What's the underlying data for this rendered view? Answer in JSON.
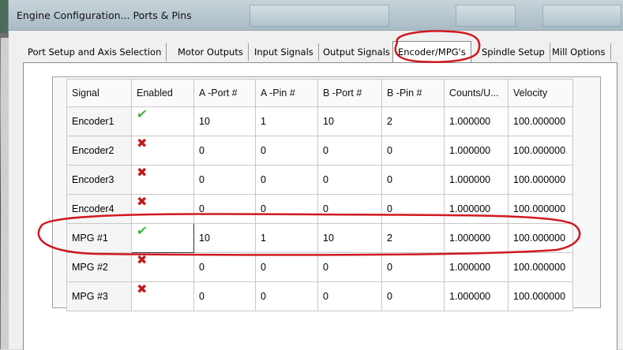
{
  "window": {
    "title": "Engine Configuration... Ports & Pins"
  },
  "tabs": [
    {
      "label": "Port Setup and Axis Selection"
    },
    {
      "label": "Motor Outputs"
    },
    {
      "label": "Input Signals"
    },
    {
      "label": "Output Signals"
    },
    {
      "label": "Encoder/MPG's"
    },
    {
      "label": "Spindle Setup"
    },
    {
      "label": "Mill Options"
    }
  ],
  "active_tab": "Encoder/MPG's",
  "grid": {
    "columns": [
      "Signal",
      "Enabled",
      "A -Port #",
      "A -Pin  #",
      "B -Port #",
      "B -Pin  #",
      "Counts/U...",
      "Velocity"
    ],
    "rows": [
      {
        "signal": "Encoder1",
        "enabled": true,
        "a_port": "10",
        "a_pin": "1",
        "b_port": "10",
        "b_pin": "2",
        "counts": "1.000000",
        "velocity": "100.000000"
      },
      {
        "signal": "Encoder2",
        "enabled": false,
        "a_port": "0",
        "a_pin": "0",
        "b_port": "0",
        "b_pin": "0",
        "counts": "1.000000",
        "velocity": "100.000000"
      },
      {
        "signal": "Encoder3",
        "enabled": false,
        "a_port": "0",
        "a_pin": "0",
        "b_port": "0",
        "b_pin": "0",
        "counts": "1.000000",
        "velocity": "100.000000"
      },
      {
        "signal": "Encoder4",
        "enabled": false,
        "a_port": "0",
        "a_pin": "0",
        "b_port": "0",
        "b_pin": "0",
        "counts": "1.000000",
        "velocity": "100.000000"
      },
      {
        "signal": "MPG #1",
        "enabled": true,
        "a_port": "10",
        "a_pin": "1",
        "b_port": "10",
        "b_pin": "2",
        "counts": "1.000000",
        "velocity": "100.000000"
      },
      {
        "signal": "MPG #2",
        "enabled": false,
        "a_port": "0",
        "a_pin": "0",
        "b_port": "0",
        "b_pin": "0",
        "counts": "1.000000",
        "velocity": "100.000000"
      },
      {
        "signal": "MPG #3",
        "enabled": false,
        "a_port": "0",
        "a_pin": "0",
        "b_port": "0",
        "b_pin": "0",
        "counts": "1.000000",
        "velocity": "100.000000"
      }
    ]
  },
  "icons": {
    "enabled_true": "green-check-icon",
    "enabled_false": "red-x-icon"
  },
  "colors": {
    "annotation": "#d0191f",
    "check": "#3fb33a",
    "cross": "#c21a1a"
  }
}
